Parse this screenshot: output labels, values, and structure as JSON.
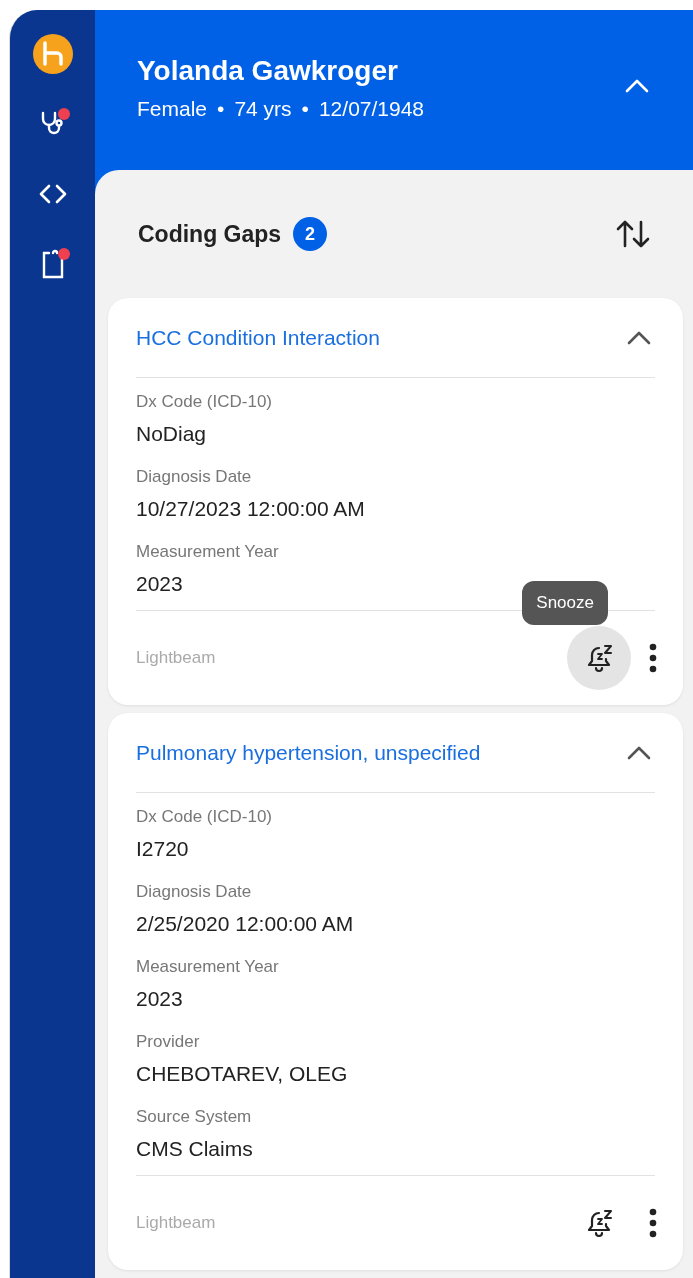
{
  "sidebar": {
    "items": [
      {
        "kind": "logo",
        "alert": false
      },
      {
        "kind": "stethoscope",
        "alert": true
      },
      {
        "kind": "code",
        "alert": false
      },
      {
        "kind": "clipboard",
        "alert": true
      }
    ]
  },
  "header": {
    "name": "Yolanda Gawkroger",
    "details": [
      "Female",
      "74 yrs",
      "12/07/1948"
    ],
    "separator": "•",
    "expanded": true
  },
  "section": {
    "title": "Coding Gaps",
    "count": "2"
  },
  "cards": [
    {
      "title": "HCC Condition Interaction",
      "expanded": true,
      "fields": [
        {
          "label": "Dx Code (ICD-10)",
          "value": "NoDiag"
        },
        {
          "label": "Diagnosis Date",
          "value": "10/27/2023 12:00:00 AM"
        },
        {
          "label": "Measurement Year",
          "value": "2023"
        }
      ],
      "source": "Lightbeam",
      "snooze_hovered": true,
      "tooltip": "Snooze"
    },
    {
      "title": "Pulmonary hypertension, unspecified",
      "expanded": true,
      "fields": [
        {
          "label": "Dx Code (ICD-10)",
          "value": "I2720"
        },
        {
          "label": "Diagnosis Date",
          "value": "2/25/2020 12:00:00 AM"
        },
        {
          "label": "Measurement Year",
          "value": "2023"
        },
        {
          "label": "Provider",
          "value": "CHEBOTAREV, OLEG"
        },
        {
          "label": "Source System",
          "value": "CMS Claims"
        }
      ],
      "source": "Lightbeam",
      "snooze_hovered": false
    }
  ]
}
